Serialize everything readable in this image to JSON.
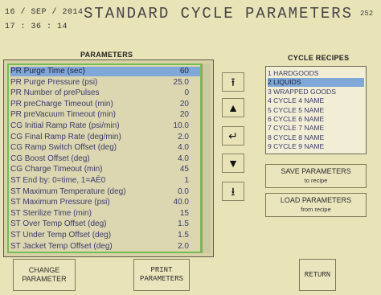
{
  "header": {
    "date": "16 / SEP / 2014",
    "time": "17 : 36 : 14",
    "title": "STANDARD CYCLE PARAMETERS",
    "screen_id": "252"
  },
  "parameters": {
    "heading": "PARAMETERS",
    "selected_index": 0,
    "rows": [
      {
        "label": "PR Purge Time (sec)",
        "value": "60"
      },
      {
        "label": "PR Purge Pressure (psi)",
        "value": "25.0"
      },
      {
        "label": "PR Number of prePulses",
        "value": "0"
      },
      {
        "label": "PR preCharge Timeout (min)",
        "value": "20"
      },
      {
        "label": "PR preVacuum Timeout (min)",
        "value": "20"
      },
      {
        "label": "CG Initial Ramp Rate (psi/min)",
        "value": "10.0"
      },
      {
        "label": "CG Final Ramp Rate (deg/min)",
        "value": "2.0"
      },
      {
        "label": "CG Ramp Switch Offset (deg)",
        "value": "4.0"
      },
      {
        "label": "CG Boost Offset (deg)",
        "value": "4.0"
      },
      {
        "label": "CG Charge Timeout (min)",
        "value": "45"
      },
      {
        "label": "ST End by: 0=time, 1=AĒ0",
        "value": "1"
      },
      {
        "label": "ST Maximum Temperature (deg)",
        "value": "0.0"
      },
      {
        "label": "ST Maximum Pressure (psi)",
        "value": "40.0"
      },
      {
        "label": "ST Sterilize Time (min)",
        "value": "15"
      },
      {
        "label": "ST Over Temp Offset (deg)",
        "value": "1.5"
      },
      {
        "label": "ST Under Temp Offset (deg)",
        "value": "1.5"
      },
      {
        "label": "ST Jacket Temp Offset (deg)",
        "value": "2.0"
      }
    ]
  },
  "nav": {
    "page_up": "⭱",
    "up": "▲",
    "enter": "↵",
    "down": "▼",
    "page_down": "⭳"
  },
  "recipes": {
    "heading": "CYCLE RECIPES",
    "selected_index": 1,
    "items": [
      "1  HARDGOODS",
      "2  LIQUIDS",
      "3  WRAPPED GOODS",
      "4  CYCLE 4 NAME",
      "5  CYCLE 5 NAME",
      "6  CYCLE 6 NAME",
      "7  CYCLE 7 NAME",
      "8  CYCLE 8 NAME",
      "9  CYCLE 9 NAME"
    ]
  },
  "buttons": {
    "save_label": "SAVE PARAMETERS",
    "save_sub": "to recipe",
    "load_label": "LOAD PARAMETERS",
    "load_sub": "from recipe",
    "change_label_1": "CHANGE",
    "change_label_2": "PARAMETER",
    "print_label_1": "PRINT",
    "print_label_2": "PARAMETERS",
    "return_label": "RETURN"
  },
  "colors": {
    "background": "#e9e3b8",
    "selection": "#7fa7d8",
    "list_border": "#74bd55"
  }
}
